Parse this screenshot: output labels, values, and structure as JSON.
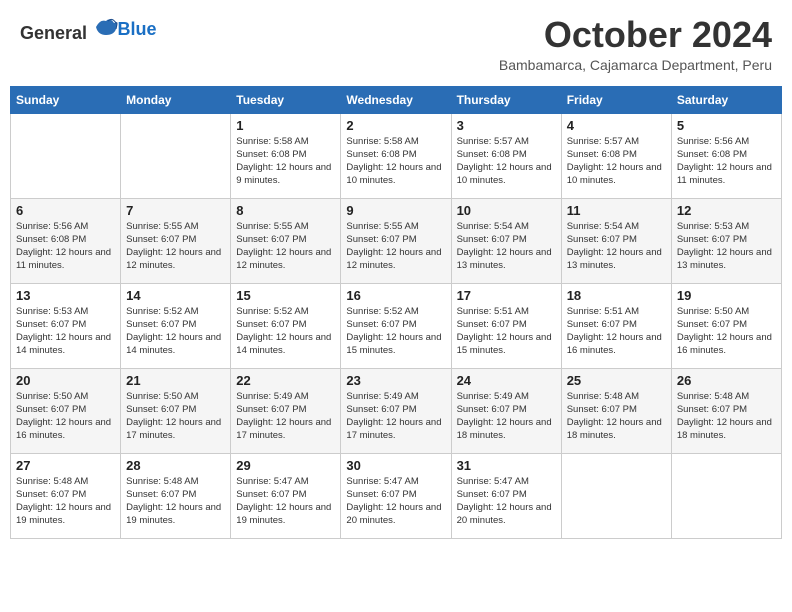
{
  "header": {
    "logo_general": "General",
    "logo_blue": "Blue",
    "month_title": "October 2024",
    "location": "Bambamarca, Cajamarca Department, Peru"
  },
  "calendar": {
    "days_of_week": [
      "Sunday",
      "Monday",
      "Tuesday",
      "Wednesday",
      "Thursday",
      "Friday",
      "Saturday"
    ],
    "weeks": [
      [
        {
          "day": "",
          "info": ""
        },
        {
          "day": "",
          "info": ""
        },
        {
          "day": "1",
          "info": "Sunrise: 5:58 AM\nSunset: 6:08 PM\nDaylight: 12 hours and 9 minutes."
        },
        {
          "day": "2",
          "info": "Sunrise: 5:58 AM\nSunset: 6:08 PM\nDaylight: 12 hours and 10 minutes."
        },
        {
          "day": "3",
          "info": "Sunrise: 5:57 AM\nSunset: 6:08 PM\nDaylight: 12 hours and 10 minutes."
        },
        {
          "day": "4",
          "info": "Sunrise: 5:57 AM\nSunset: 6:08 PM\nDaylight: 12 hours and 10 minutes."
        },
        {
          "day": "5",
          "info": "Sunrise: 5:56 AM\nSunset: 6:08 PM\nDaylight: 12 hours and 11 minutes."
        }
      ],
      [
        {
          "day": "6",
          "info": "Sunrise: 5:56 AM\nSunset: 6:08 PM\nDaylight: 12 hours and 11 minutes."
        },
        {
          "day": "7",
          "info": "Sunrise: 5:55 AM\nSunset: 6:07 PM\nDaylight: 12 hours and 12 minutes."
        },
        {
          "day": "8",
          "info": "Sunrise: 5:55 AM\nSunset: 6:07 PM\nDaylight: 12 hours and 12 minutes."
        },
        {
          "day": "9",
          "info": "Sunrise: 5:55 AM\nSunset: 6:07 PM\nDaylight: 12 hours and 12 minutes."
        },
        {
          "day": "10",
          "info": "Sunrise: 5:54 AM\nSunset: 6:07 PM\nDaylight: 12 hours and 13 minutes."
        },
        {
          "day": "11",
          "info": "Sunrise: 5:54 AM\nSunset: 6:07 PM\nDaylight: 12 hours and 13 minutes."
        },
        {
          "day": "12",
          "info": "Sunrise: 5:53 AM\nSunset: 6:07 PM\nDaylight: 12 hours and 13 minutes."
        }
      ],
      [
        {
          "day": "13",
          "info": "Sunrise: 5:53 AM\nSunset: 6:07 PM\nDaylight: 12 hours and 14 minutes."
        },
        {
          "day": "14",
          "info": "Sunrise: 5:52 AM\nSunset: 6:07 PM\nDaylight: 12 hours and 14 minutes."
        },
        {
          "day": "15",
          "info": "Sunrise: 5:52 AM\nSunset: 6:07 PM\nDaylight: 12 hours and 14 minutes."
        },
        {
          "day": "16",
          "info": "Sunrise: 5:52 AM\nSunset: 6:07 PM\nDaylight: 12 hours and 15 minutes."
        },
        {
          "day": "17",
          "info": "Sunrise: 5:51 AM\nSunset: 6:07 PM\nDaylight: 12 hours and 15 minutes."
        },
        {
          "day": "18",
          "info": "Sunrise: 5:51 AM\nSunset: 6:07 PM\nDaylight: 12 hours and 16 minutes."
        },
        {
          "day": "19",
          "info": "Sunrise: 5:50 AM\nSunset: 6:07 PM\nDaylight: 12 hours and 16 minutes."
        }
      ],
      [
        {
          "day": "20",
          "info": "Sunrise: 5:50 AM\nSunset: 6:07 PM\nDaylight: 12 hours and 16 minutes."
        },
        {
          "day": "21",
          "info": "Sunrise: 5:50 AM\nSunset: 6:07 PM\nDaylight: 12 hours and 17 minutes."
        },
        {
          "day": "22",
          "info": "Sunrise: 5:49 AM\nSunset: 6:07 PM\nDaylight: 12 hours and 17 minutes."
        },
        {
          "day": "23",
          "info": "Sunrise: 5:49 AM\nSunset: 6:07 PM\nDaylight: 12 hours and 17 minutes."
        },
        {
          "day": "24",
          "info": "Sunrise: 5:49 AM\nSunset: 6:07 PM\nDaylight: 12 hours and 18 minutes."
        },
        {
          "day": "25",
          "info": "Sunrise: 5:48 AM\nSunset: 6:07 PM\nDaylight: 12 hours and 18 minutes."
        },
        {
          "day": "26",
          "info": "Sunrise: 5:48 AM\nSunset: 6:07 PM\nDaylight: 12 hours and 18 minutes."
        }
      ],
      [
        {
          "day": "27",
          "info": "Sunrise: 5:48 AM\nSunset: 6:07 PM\nDaylight: 12 hours and 19 minutes."
        },
        {
          "day": "28",
          "info": "Sunrise: 5:48 AM\nSunset: 6:07 PM\nDaylight: 12 hours and 19 minutes."
        },
        {
          "day": "29",
          "info": "Sunrise: 5:47 AM\nSunset: 6:07 PM\nDaylight: 12 hours and 19 minutes."
        },
        {
          "day": "30",
          "info": "Sunrise: 5:47 AM\nSunset: 6:07 PM\nDaylight: 12 hours and 20 minutes."
        },
        {
          "day": "31",
          "info": "Sunrise: 5:47 AM\nSunset: 6:07 PM\nDaylight: 12 hours and 20 minutes."
        },
        {
          "day": "",
          "info": ""
        },
        {
          "day": "",
          "info": ""
        }
      ]
    ]
  }
}
